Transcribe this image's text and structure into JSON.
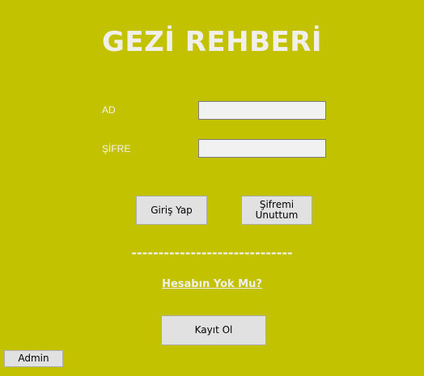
{
  "title": "GEZİ REHBERİ",
  "form": {
    "name_label": "AD",
    "name_value": "",
    "password_label": "ŞİFRE",
    "password_value": ""
  },
  "buttons": {
    "login": "Giriş Yap",
    "forgot": "Şifremi\nUnuttum",
    "register": "Kayıt Ol",
    "admin": "Admin"
  },
  "divider": "------------------------------",
  "no_account_link": "Hesabın Yok Mu?"
}
